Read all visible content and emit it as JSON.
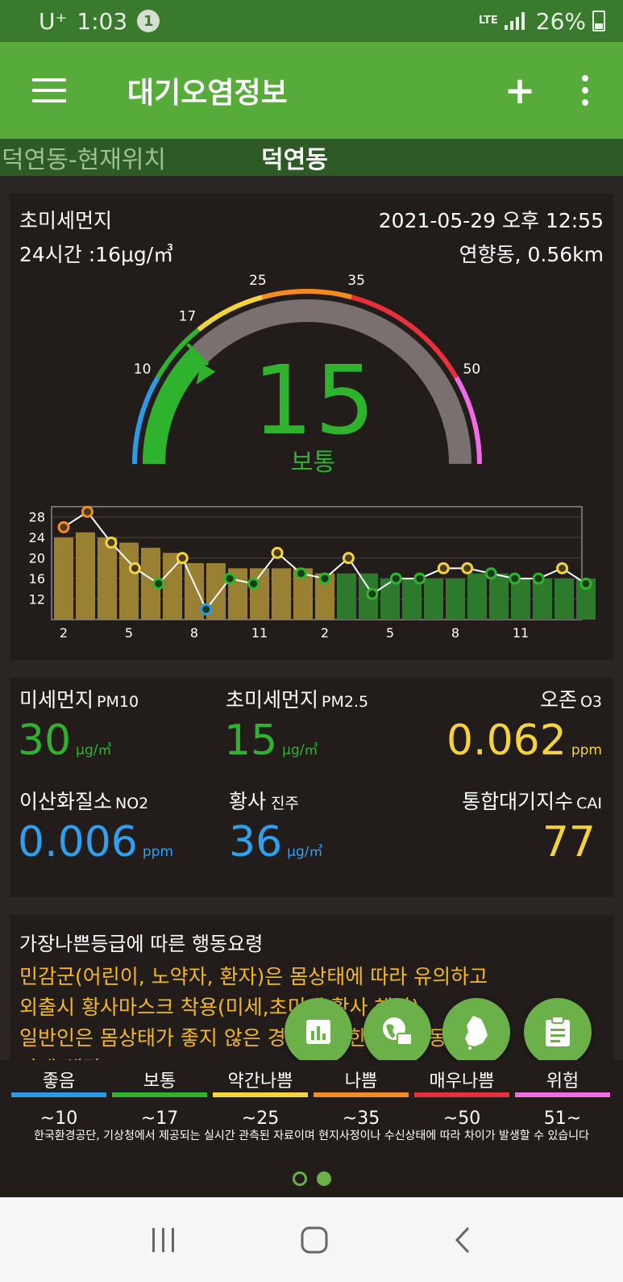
{
  "status": {
    "carrier": "U⁺",
    "time": "1:03",
    "notif_count": "1",
    "network": "LTE",
    "battery": "26%"
  },
  "app": {
    "title": "대기오염정보"
  },
  "tabs": [
    "덕연동-현재위치",
    "덕연동"
  ],
  "main": {
    "pollutant": "초미세먼지",
    "avg24": "24시간 :16μg/㎥",
    "datetime": "2021-05-29 오후 12:55",
    "station": "연향동, 0.56km",
    "gauge": {
      "value": "15",
      "grade": "보통",
      "ticks": [
        "10",
        "17",
        "25",
        "35",
        "50"
      ],
      "max": 60
    }
  },
  "chart_data": {
    "type": "bar",
    "x_tick_labels": [
      "2",
      "5",
      "8",
      "11",
      "2",
      "5",
      "8",
      "11"
    ],
    "y_tick_labels": [
      "12",
      "16",
      "20",
      "24",
      "28"
    ],
    "ylim": [
      8,
      30
    ],
    "series": [
      {
        "values": [
          24,
          25,
          24,
          23,
          22,
          21,
          19,
          19,
          18,
          18,
          18,
          18,
          17,
          17,
          17,
          16,
          16,
          16,
          16,
          17,
          17,
          16,
          16,
          16,
          16
        ]
      },
      {
        "values": [
          26,
          29,
          23,
          18,
          15,
          20,
          10,
          16,
          15,
          21,
          17,
          16,
          20,
          13,
          16,
          16,
          18,
          18,
          17,
          16,
          16,
          18,
          15
        ]
      }
    ]
  },
  "measurements": {
    "pm10": {
      "label": "미세먼지",
      "sub": "PM10",
      "value": "30",
      "unit": "μg/㎥"
    },
    "pm25": {
      "label": "초미세먼지",
      "sub": "PM2.5",
      "value": "15",
      "unit": "μg/㎥"
    },
    "o3": {
      "label": "오존",
      "sub": "O3",
      "value": "0.062",
      "unit": "ppm"
    },
    "no2": {
      "label": "이산화질소",
      "sub": "NO2",
      "value": "0.006",
      "unit": "ppm"
    },
    "dust": {
      "label": "황사",
      "sub": "진주",
      "value": "36",
      "unit": "μg/㎥"
    },
    "cai": {
      "label": "통합대기지수",
      "sub": "CAI",
      "value": "77"
    }
  },
  "guide": {
    "title": "가장나쁜등급에 따른 행동요령",
    "lines": [
      "민감군(어린이, 노약자, 환자)은 몸상태에 따라 유의하고",
      "외출시 황사마스크 착용(미세,초미세,황사 해당).",
      "일반인은 몸상태가 좋지 않은 경우 무리한 실외활동",
      "자제(해당:..."
    ]
  },
  "legend": [
    {
      "name": "좋음",
      "range": "~10",
      "color": "#2b9be8"
    },
    {
      "name": "보통",
      "range": "~17",
      "color": "#2fb32f"
    },
    {
      "name": "약간나쁨",
      "range": "~25",
      "color": "#f5d33c"
    },
    {
      "name": "나쁨",
      "range": "~35",
      "color": "#f58a1f"
    },
    {
      "name": "매우나쁨",
      "range": "~50",
      "color": "#e8303a"
    },
    {
      "name": "위험",
      "range": "51~",
      "color": "#f26be6"
    }
  ],
  "notice": "한국환경공단, 기상청에서 제공되는 실시간 관측된 자료이며 현지사정이나 수신상태에 따라 차이가 발생할 수 있습니다",
  "fabs": [
    "chart-icon",
    "globe-chat-icon",
    "korea-map-icon",
    "clipboard-icon"
  ],
  "colors": {
    "good": "#2b9be8",
    "normal": "#2fb32f",
    "fair": "#f5d33c",
    "bad": "#f58a1f",
    "very_bad": "#e8303a",
    "hazard": "#f26be6",
    "appbar": "#56ab3a",
    "gold_bar": "#9a8033",
    "green_bar": "#2d7a2d",
    "value_blue": "#2fa0ee",
    "value_yellow": "#f5d33c"
  }
}
